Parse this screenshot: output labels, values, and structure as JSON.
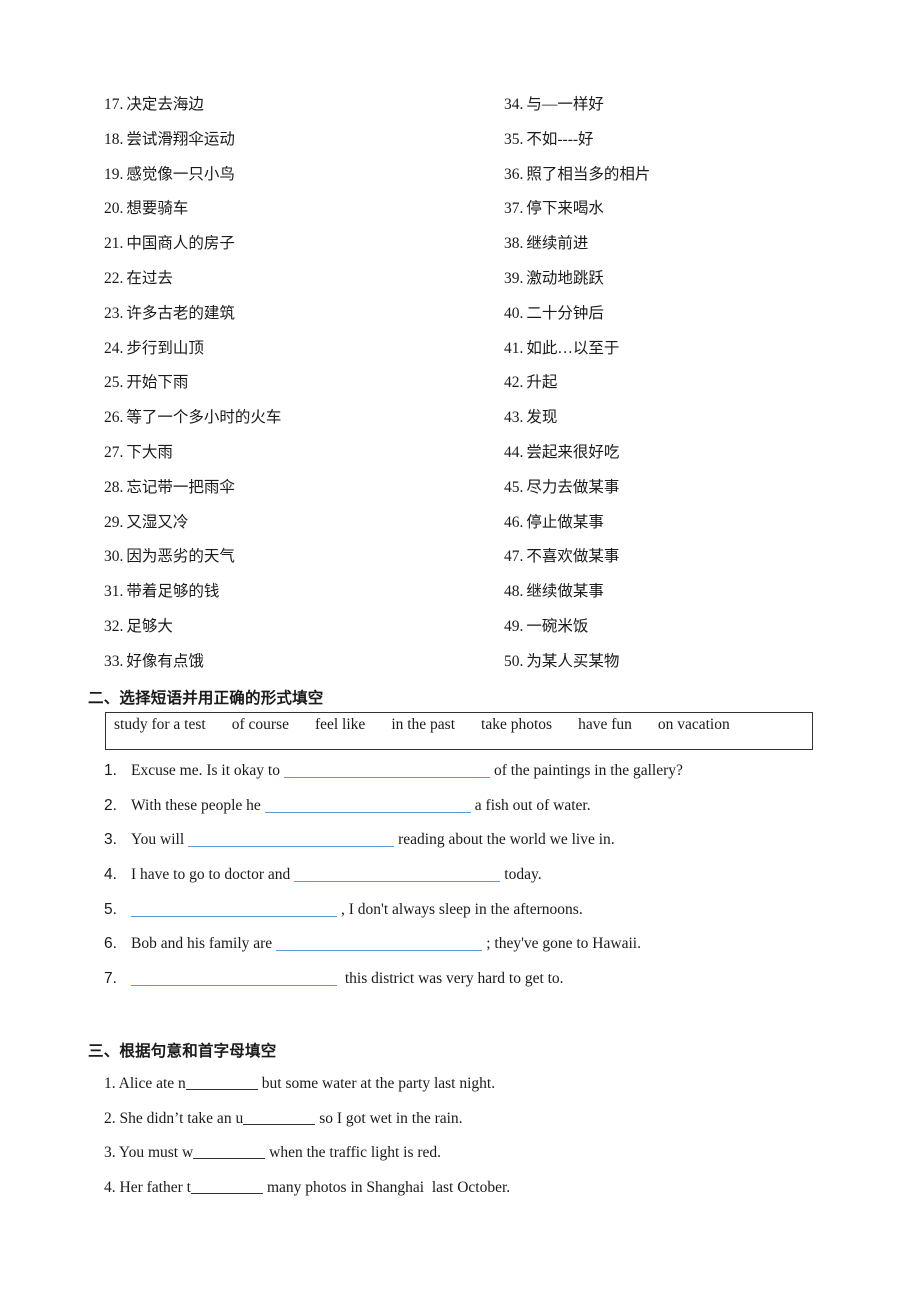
{
  "vocab_left": [
    {
      "num": "17.",
      "text": "决定去海边"
    },
    {
      "num": "18.",
      "text": "尝试滑翔伞运动"
    },
    {
      "num": "19.",
      "text": "感觉像一只小鸟"
    },
    {
      "num": "20.",
      "text": "想要骑车"
    },
    {
      "num": "21.",
      "text": "中国商人的房子"
    },
    {
      "num": "22.",
      "text": "在过去"
    },
    {
      "num": "23.",
      "text": "许多古老的建筑"
    },
    {
      "num": "24.",
      "text": "步行到山顶"
    },
    {
      "num": "25.",
      "text": "开始下雨"
    },
    {
      "num": "26.",
      "text": "等了一个多小时的火车"
    },
    {
      "num": "27.",
      "text": "下大雨"
    },
    {
      "num": "28.",
      "text": "忘记带一把雨伞"
    },
    {
      "num": "29.",
      "text": "又湿又冷"
    },
    {
      "num": "30.",
      "text": "因为恶劣的天气"
    },
    {
      "num": "31.",
      "text": "带着足够的钱"
    },
    {
      "num": "32.",
      "text": "足够大"
    },
    {
      "num": "33.",
      "text": "好像有点饿"
    }
  ],
  "vocab_right": [
    {
      "num": "34.",
      "text": "与—一样好"
    },
    {
      "num": "35.",
      "text": "不如----好"
    },
    {
      "num": "36.",
      "text": "照了相当多的相片"
    },
    {
      "num": "37.",
      "text": "停下来喝水"
    },
    {
      "num": "38.",
      "text": "继续前进"
    },
    {
      "num": "39.",
      "text": "激动地跳跃"
    },
    {
      "num": "40.",
      "text": "二十分钟后"
    },
    {
      "num": "41.",
      "text": "如此…以至于"
    },
    {
      "num": "42.",
      "text": "升起"
    },
    {
      "num": "43.",
      "text": "发现"
    },
    {
      "num": "44.",
      "text": "尝起来很好吃"
    },
    {
      "num": "45.",
      "text": "尽力去做某事"
    },
    {
      "num": "46.",
      "text": "停止做某事"
    },
    {
      "num": "47.",
      "text": "不喜欢做某事"
    },
    {
      "num": "48.",
      "text": "继续做某事"
    },
    {
      "num": "49.",
      "text": "一碗米饭"
    },
    {
      "num": "50.",
      "text": "为某人买某物"
    }
  ],
  "section2": {
    "title": "二、选择短语并用正确的形式填空",
    "word_bank": [
      "study for a test",
      "of course",
      "feel like",
      "in the past",
      "take photos",
      "have fun",
      "on vacation"
    ],
    "items": [
      {
        "num": "1.",
        "before": "Excuse me. Is it okay to",
        "after": "of the paintings in the gallery?"
      },
      {
        "num": "2.",
        "before": "With these people he",
        "after": "a fish out of water."
      },
      {
        "num": "3.",
        "before": "You will",
        "after": "reading about the world we live in."
      },
      {
        "num": "4.",
        "before": "I have to go to doctor and",
        "after": "today."
      },
      {
        "num": "5.",
        "before": "",
        "after": ", I don't always sleep in the afternoons."
      },
      {
        "num": "6.",
        "before": "Bob and his family are",
        "after": "; they've gone to Hawaii."
      },
      {
        "num": "7.",
        "before": "",
        "after": " this district was very hard to get to."
      }
    ]
  },
  "section3": {
    "title": "三、根据句意和首字母填空",
    "items": [
      {
        "before": "1. Alice ate n",
        "after": "but some water at the party last night."
      },
      {
        "before": "2. She didn’t take an u",
        "after": "so I got wet in the rain."
      },
      {
        "before": "3. You must w",
        "after": "when the traffic light is red."
      },
      {
        "before": "4. Her father t",
        "after": "many photos in Shanghai  last October."
      }
    ]
  }
}
